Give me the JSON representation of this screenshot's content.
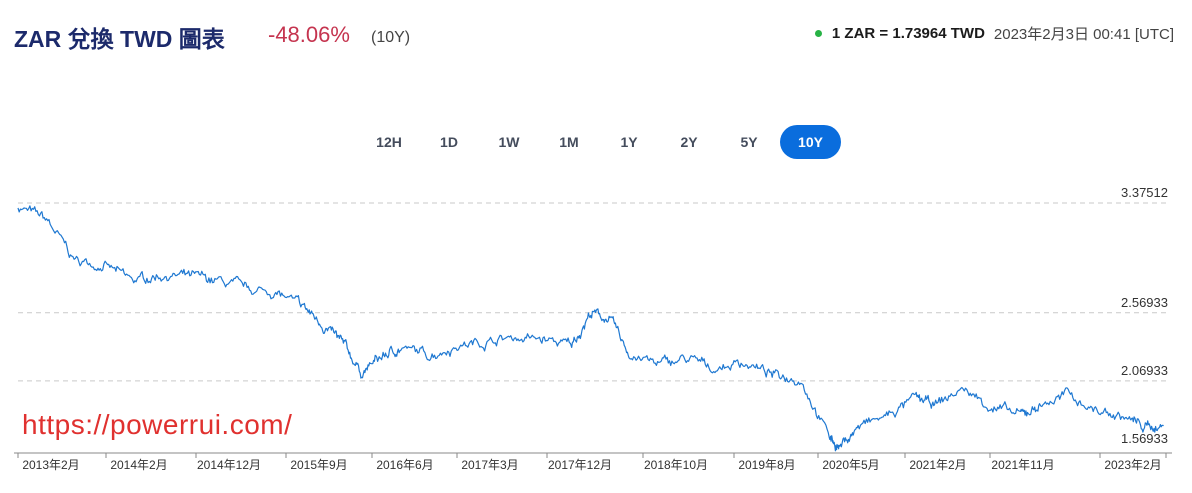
{
  "header": {
    "title": "ZAR 兌換 TWD 圖表",
    "change": "-48.06%",
    "period": "(10Y)",
    "rate": "1 ZAR = 1.73964 TWD",
    "timestamp": "2023年2月3日 00:41 [UTC]"
  },
  "ranges": [
    {
      "label": "12H",
      "active": false
    },
    {
      "label": "1D",
      "active": false
    },
    {
      "label": "1W",
      "active": false
    },
    {
      "label": "1M",
      "active": false
    },
    {
      "label": "1Y",
      "active": false
    },
    {
      "label": "2Y",
      "active": false
    },
    {
      "label": "5Y",
      "active": false
    },
    {
      "label": "10Y",
      "active": true
    }
  ],
  "watermark": "https://powerrui.com/",
  "colors": {
    "line": "#1f78d1",
    "title": "#1c2a6b",
    "change": "#c5344f",
    "active_range": "#0a6ddd",
    "status_dot": "#27b245"
  },
  "chart_data": {
    "type": "line",
    "title": "",
    "xlabel": "",
    "ylabel": "",
    "ylim": [
      1.5,
      3.45
    ],
    "y_ticks": [
      {
        "value": 3.37512,
        "label": "3.37512"
      },
      {
        "value": 2.56933,
        "label": "2.56933"
      },
      {
        "value": 2.06933,
        "label": "2.06933"
      },
      {
        "value": 1.56933,
        "label": "1.56933"
      }
    ],
    "x_ticks": [
      "2013年2月",
      "2014年2月",
      "2014年12月",
      "2015年9月",
      "2016年6月",
      "2017年3月",
      "2017年12月",
      "2018年10月",
      "2019年8月",
      "2020年5月",
      "2021年2月",
      "2021年11月",
      "2023年2月"
    ],
    "x": [
      "2013-02",
      "2013-05",
      "2013-08",
      "2013-11",
      "2014-02",
      "2014-05",
      "2014-08",
      "2014-11",
      "2015-02",
      "2015-05",
      "2015-08",
      "2015-10",
      "2015-12",
      "2016-02",
      "2016-04",
      "2016-06",
      "2016-09",
      "2016-12",
      "2017-03",
      "2017-06",
      "2017-09",
      "2017-12",
      "2018-02",
      "2018-04",
      "2018-06",
      "2018-09",
      "2018-12",
      "2019-03",
      "2019-06",
      "2019-09",
      "2019-12",
      "2020-03",
      "2020-04",
      "2020-06",
      "2020-09",
      "2020-12",
      "2021-02",
      "2021-05",
      "2021-08",
      "2021-11",
      "2022-01",
      "2022-04",
      "2022-07",
      "2022-10",
      "2022-12",
      "2023-02"
    ],
    "y": [
      3.35,
      3.25,
      2.95,
      2.92,
      2.8,
      2.85,
      2.83,
      2.8,
      2.74,
      2.72,
      2.6,
      2.48,
      2.34,
      2.13,
      2.24,
      2.31,
      2.26,
      2.33,
      2.36,
      2.39,
      2.37,
      2.33,
      2.57,
      2.52,
      2.27,
      2.19,
      2.23,
      2.16,
      2.21,
      2.11,
      2.09,
      1.66,
      1.58,
      1.73,
      1.81,
      1.94,
      1.89,
      2.01,
      1.88,
      1.81,
      1.89,
      1.97,
      1.85,
      1.8,
      1.73,
      1.74
    ],
    "grid": "horizontal dashed",
    "legend": "none"
  }
}
